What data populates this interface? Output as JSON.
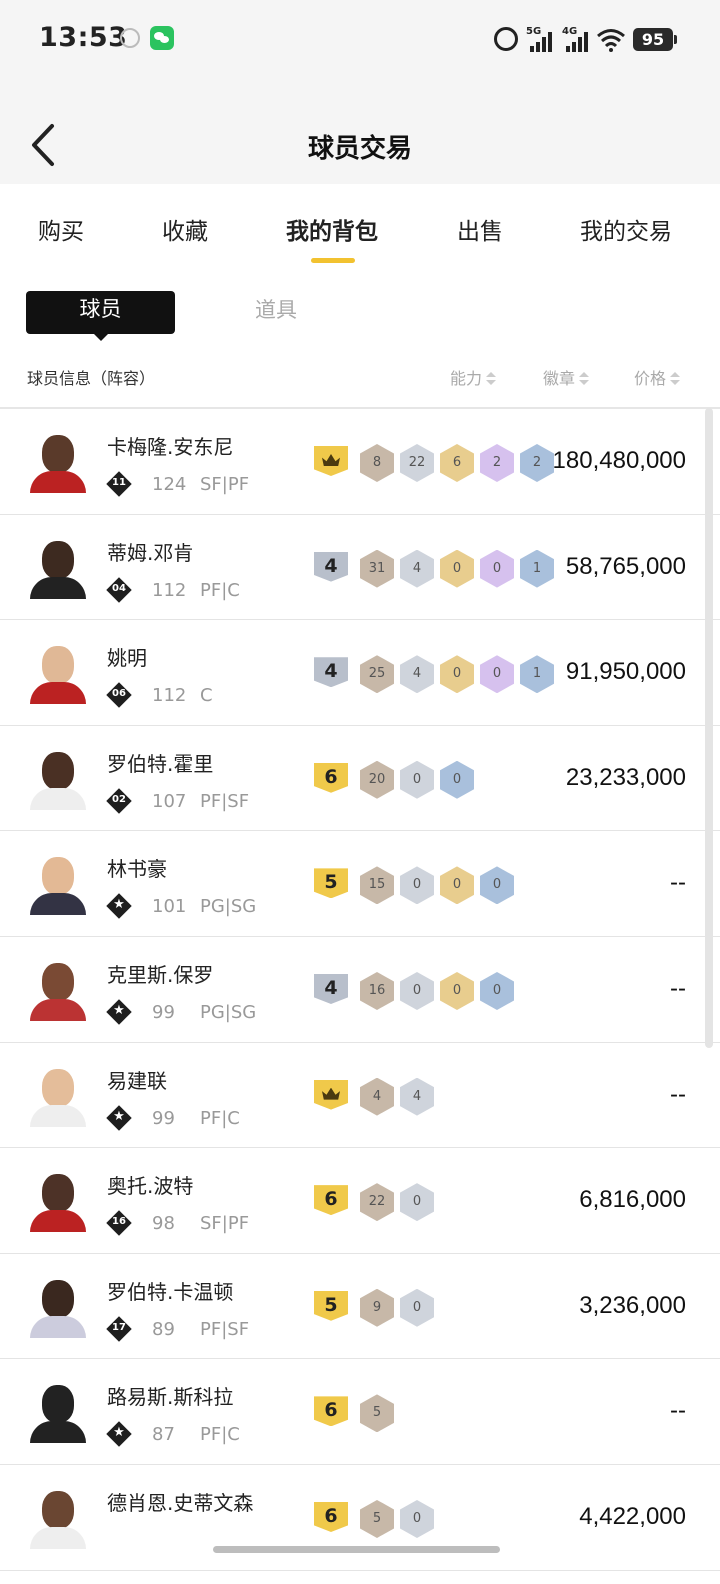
{
  "status_bar": {
    "time": "13:53",
    "network1": "5G",
    "network2": "4G",
    "battery": "95"
  },
  "header": {
    "title": "球员交易"
  },
  "tabs": [
    {
      "label": "购买"
    },
    {
      "label": "收藏"
    },
    {
      "label": "我的背包",
      "active": true
    },
    {
      "label": "出售"
    },
    {
      "label": "我的交易"
    }
  ],
  "segments": {
    "players": "球员",
    "items": "道具"
  },
  "columns": {
    "info": "球员信息（阵容）",
    "ability": "能力",
    "badges": "徽章",
    "price": "价格"
  },
  "players": [
    {
      "name": "卡梅隆.安东尼",
      "jersey": "11",
      "ovr": "124",
      "pos": "SF|PF",
      "tier": "crown",
      "badges": [
        {
          "v": "8",
          "c": "bronze"
        },
        {
          "v": "22",
          "c": "silverh"
        },
        {
          "v": "6",
          "c": "goldh"
        },
        {
          "v": "2",
          "c": "purple"
        },
        {
          "v": "2",
          "c": "blue"
        }
      ],
      "price": "180,480,000"
    },
    {
      "name": "蒂姆.邓肯",
      "jersey": "04",
      "ovr": "112",
      "pos": "PF|C",
      "tier": "4",
      "badges": [
        {
          "v": "31",
          "c": "bronze"
        },
        {
          "v": "4",
          "c": "silverh"
        },
        {
          "v": "0",
          "c": "goldh"
        },
        {
          "v": "0",
          "c": "purple"
        },
        {
          "v": "1",
          "c": "blue"
        }
      ],
      "price": "58,765,000"
    },
    {
      "name": "姚明",
      "jersey": "06",
      "ovr": "112",
      "pos": "C",
      "tier": "4",
      "badges": [
        {
          "v": "25",
          "c": "bronze"
        },
        {
          "v": "4",
          "c": "silverh"
        },
        {
          "v": "0",
          "c": "goldh"
        },
        {
          "v": "0",
          "c": "purple"
        },
        {
          "v": "1",
          "c": "blue"
        }
      ],
      "price": "91,950,000"
    },
    {
      "name": "罗伯特.霍里",
      "jersey": "02",
      "ovr": "107",
      "pos": "PF|SF",
      "tier": "6",
      "badges": [
        {
          "v": "20",
          "c": "bronze"
        },
        {
          "v": "0",
          "c": "silverh"
        },
        {
          "v": "0",
          "c": "blue"
        }
      ],
      "price": "23,233,000"
    },
    {
      "name": "林书豪",
      "jersey": "★",
      "ovr": "101",
      "pos": "PG|SG",
      "tier": "5",
      "badges": [
        {
          "v": "15",
          "c": "bronze"
        },
        {
          "v": "0",
          "c": "silverh"
        },
        {
          "v": "0",
          "c": "goldh"
        },
        {
          "v": "0",
          "c": "blue"
        }
      ],
      "price": "--"
    },
    {
      "name": "克里斯.保罗",
      "jersey": "★",
      "ovr": "99",
      "pos": "PG|SG",
      "tier": "4",
      "badges": [
        {
          "v": "16",
          "c": "bronze"
        },
        {
          "v": "0",
          "c": "silverh"
        },
        {
          "v": "0",
          "c": "goldh"
        },
        {
          "v": "0",
          "c": "blue"
        }
      ],
      "price": "--"
    },
    {
      "name": "易建联",
      "jersey": "★",
      "ovr": "99",
      "pos": "PF|C",
      "tier": "crown",
      "badges": [
        {
          "v": "4",
          "c": "bronze"
        },
        {
          "v": "4",
          "c": "silverh"
        }
      ],
      "price": "--"
    },
    {
      "name": "奥托.波特",
      "jersey": "16",
      "ovr": "98",
      "pos": "SF|PF",
      "tier": "6",
      "badges": [
        {
          "v": "22",
          "c": "bronze"
        },
        {
          "v": "0",
          "c": "silverh"
        }
      ],
      "price": "6,816,000"
    },
    {
      "name": "罗伯特.卡温顿",
      "jersey": "17",
      "ovr": "89",
      "pos": "PF|SF",
      "tier": "5",
      "badges": [
        {
          "v": "9",
          "c": "bronze"
        },
        {
          "v": "0",
          "c": "silverh"
        }
      ],
      "price": "3,236,000"
    },
    {
      "name": "路易斯.斯科拉",
      "jersey": "★",
      "ovr": "87",
      "pos": "PF|C",
      "tier": "6",
      "badges": [
        {
          "v": "5",
          "c": "bronze"
        }
      ],
      "price": "--"
    },
    {
      "name": "德肖恩.史蒂文森",
      "jersey": "",
      "ovr": "",
      "pos": "",
      "tier": "6",
      "badges": [
        {
          "v": "5",
          "c": "bronze"
        },
        {
          "v": "0",
          "c": "silverh"
        }
      ],
      "price": "4,422,000"
    }
  ]
}
